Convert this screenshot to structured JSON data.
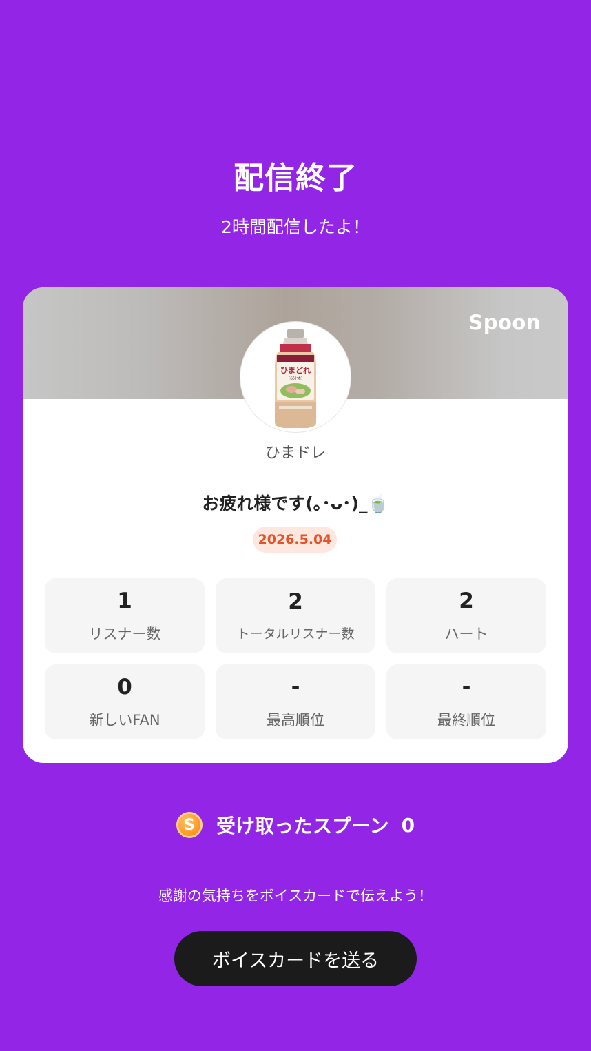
{
  "header": {
    "title": "配信終了",
    "subtitle": "2時間配信したよ！"
  },
  "card": {
    "brand": "Spoon",
    "avatar_icon": "dressing-bottle-image",
    "avatar_label_text": "ひまどれ",
    "avatar_sub_text": "(6分休)",
    "username": "ひまドレ",
    "message": "お疲れ様です(｡･ᴗ･)_🍵",
    "date": "2026.5.04"
  },
  "stats": [
    {
      "value": "1",
      "label": "リスナー数"
    },
    {
      "value": "2",
      "label": "トータルリスナー数"
    },
    {
      "value": "2",
      "label": "ハート"
    },
    {
      "value": "0",
      "label": "新しいFAN"
    },
    {
      "value": "-",
      "label": "最高順位"
    },
    {
      "value": "-",
      "label": "最終順位"
    }
  ],
  "spoons": {
    "icon": "spoon-coin-icon",
    "coin_letter": "S",
    "label": "受け取ったスプーン",
    "count": "0"
  },
  "thanks_text": "感謝の気持ちをボイスカードで伝えよう！",
  "voice_card_button": "ボイスカードを送る",
  "colors": {
    "background": "#9325e6",
    "date_badge_text": "#e4532a",
    "date_badge_bg": "#fde7df",
    "button_bg": "#1b1b1b"
  }
}
